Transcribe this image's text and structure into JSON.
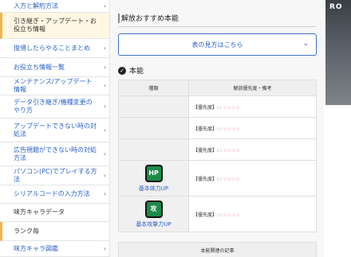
{
  "sidebar": {
    "items": [
      {
        "label": "入方と解約方法"
      },
      {
        "label": "引き継ぎ・アップデート・お役立ち情報"
      },
      {
        "label": "復帰したらやることまとめ"
      },
      {
        "label": "お役立ち情報一覧"
      },
      {
        "label": "メンテナンス/アップデート情報"
      },
      {
        "label": "データ引き継ぎ/機種変更のやり方"
      },
      {
        "label": "アップデートできない時の対処法"
      },
      {
        "label": "広告視聴ができない時の対処方法"
      },
      {
        "label": "パソコン(PC)でプレイする方法"
      },
      {
        "label": "シリアルコードの入力方法"
      },
      {
        "label": "味方キャラデータ"
      },
      {
        "label": "ランク毎"
      },
      {
        "label": "味方キャラ図鑑"
      }
    ]
  },
  "main": {
    "section_title": "解放おすすめ本能",
    "guide_button": "表の見方はこちら",
    "subhead": "本能",
    "table": {
      "headers": [
        "種類",
        "解放優先度・備考"
      ],
      "rows": [
        {
          "type": "",
          "priority_label": "【優先度】:",
          "stars": "☆☆☆☆☆"
        },
        {
          "type": "",
          "priority_label": "【優先度】:",
          "stars": "☆☆☆☆☆"
        },
        {
          "type": "",
          "priority_label": "【優先度】:",
          "stars": "☆☆☆☆☆"
        },
        {
          "type": "基本体力UP",
          "icon_text": "HP",
          "priority_label": "【優先度】:",
          "stars": "☆☆☆☆☆"
        },
        {
          "type": "基本攻撃力UP",
          "icon_text": "攻",
          "priority_label": "【優先度】:",
          "stars": "☆☆☆☆☆"
        }
      ]
    },
    "related": "本能関連の記事"
  },
  "ad": {
    "text": "RO"
  },
  "colors": {
    "link": "#2a62c9",
    "accent": "#f0b44c",
    "star": "#f08aa0",
    "icon_bg": "#1d8a49"
  }
}
